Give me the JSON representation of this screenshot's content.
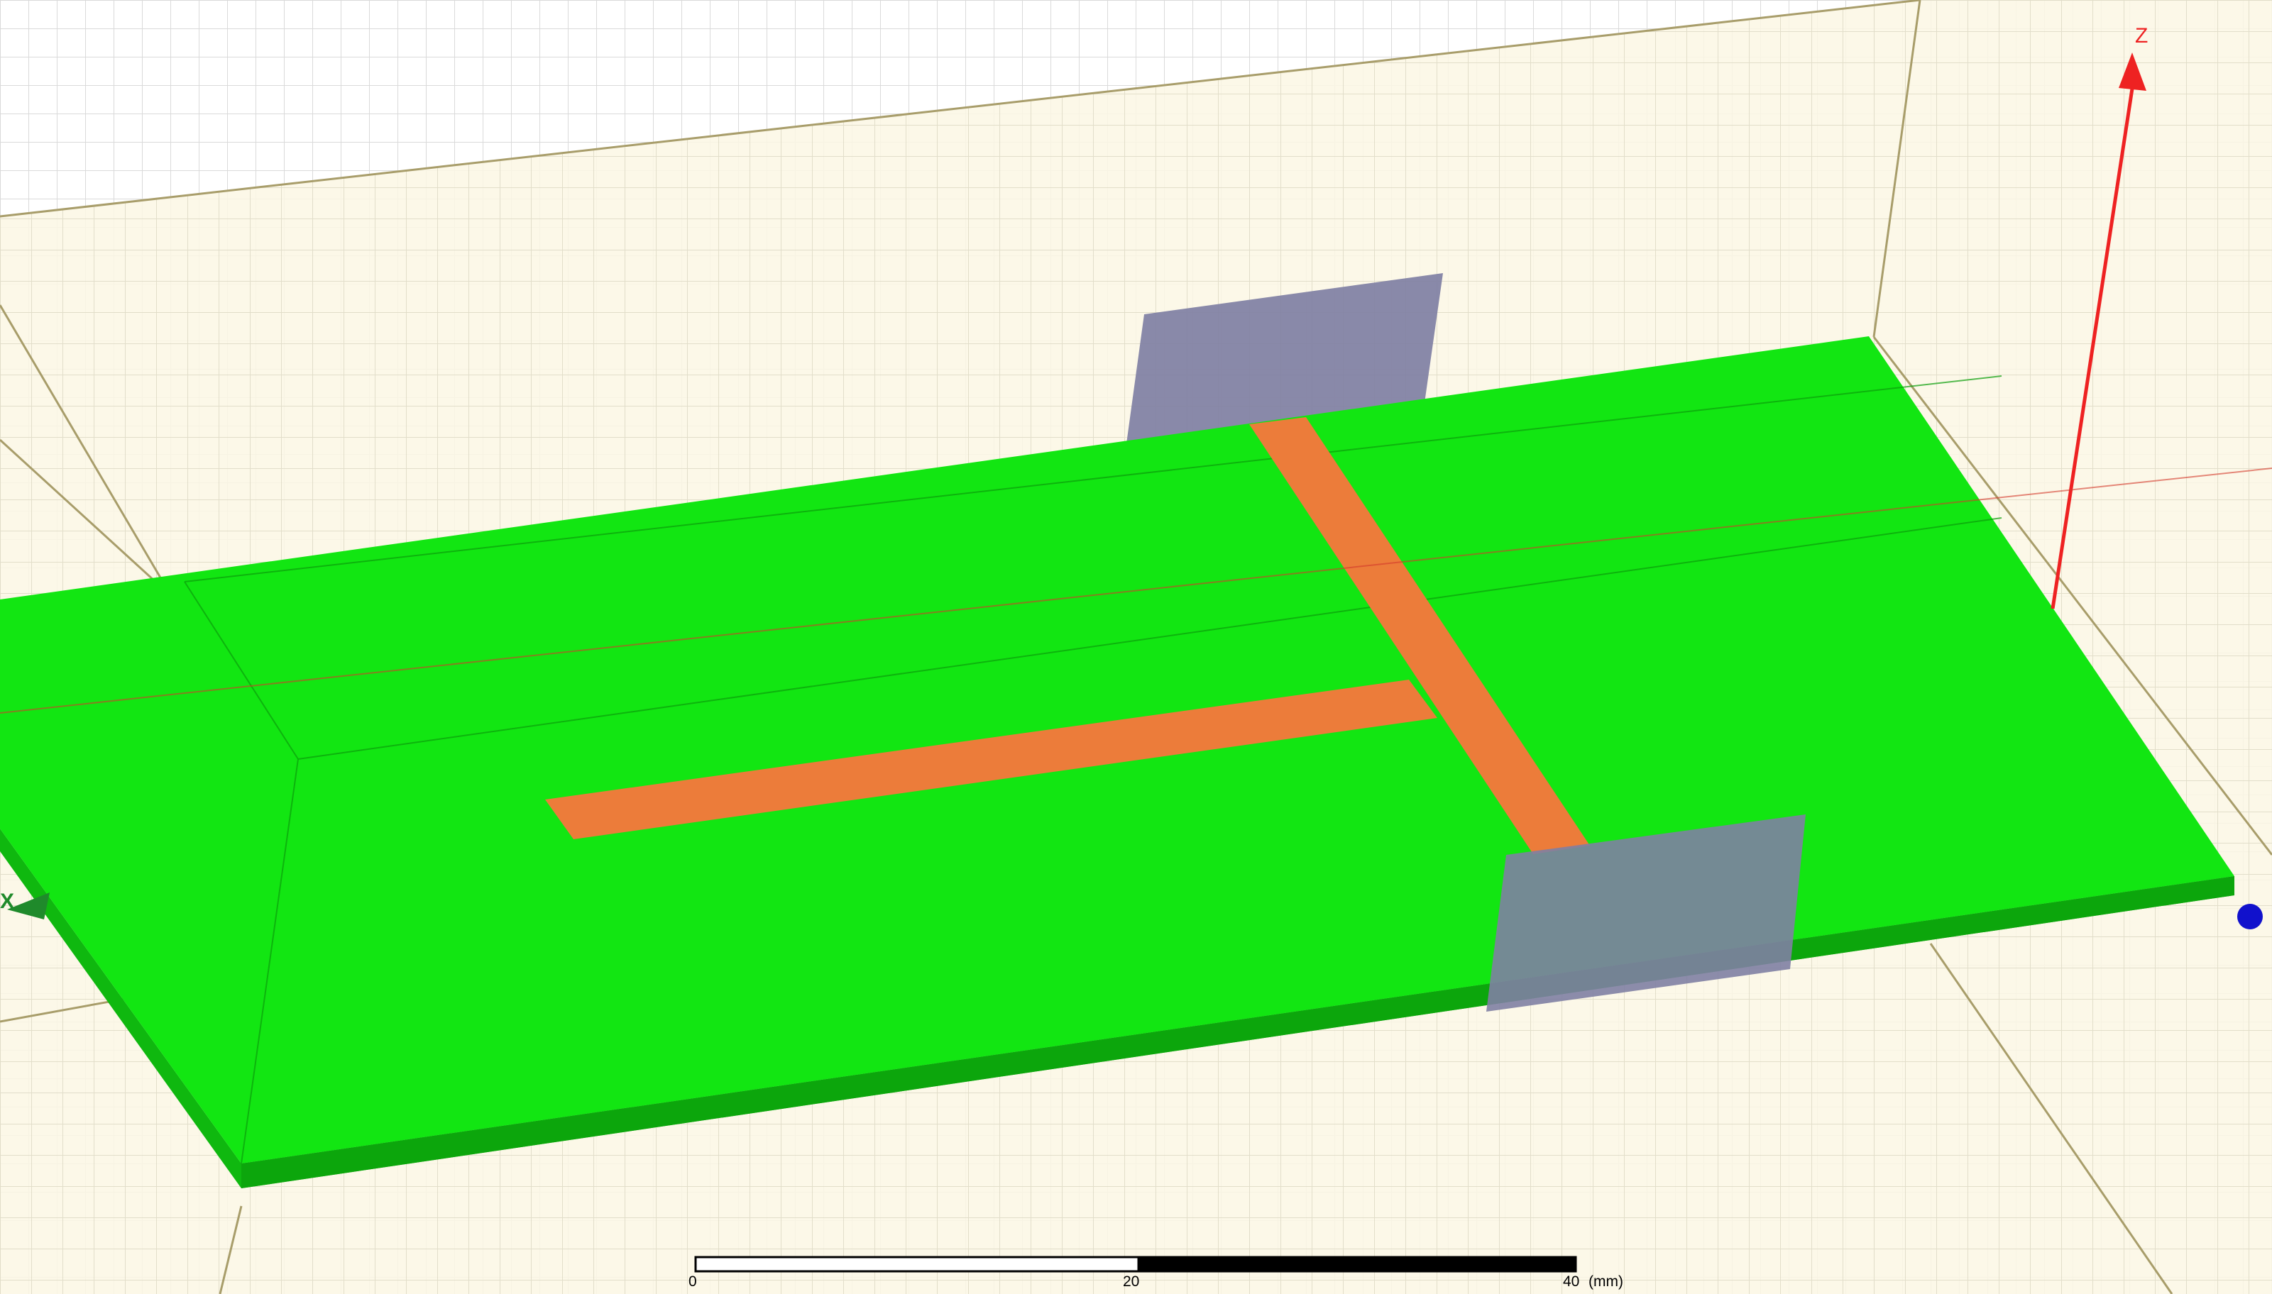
{
  "viewport": {
    "background_color": "#fbf7e6",
    "grid_color": "#d8d4c4",
    "outer_grid_color": "#dadada",
    "box_edge_color": "#9a9060"
  },
  "model": {
    "substrate_color": "#12e612",
    "substrate_side_color": "#0fb80f",
    "substrate_edge_color": "#0b9e0b",
    "microstrip_color": "#ec7c3a",
    "port_color": "#7f7fa3"
  },
  "axes": {
    "z_label": "Z",
    "x_label": "X",
    "z_color": "#ee2222",
    "x_color": "#1f8a2b",
    "y_color": "#1111cc"
  },
  "scale_bar": {
    "tick_0": "0",
    "tick_20": "20",
    "tick_40": "40",
    "unit": "(mm)"
  }
}
